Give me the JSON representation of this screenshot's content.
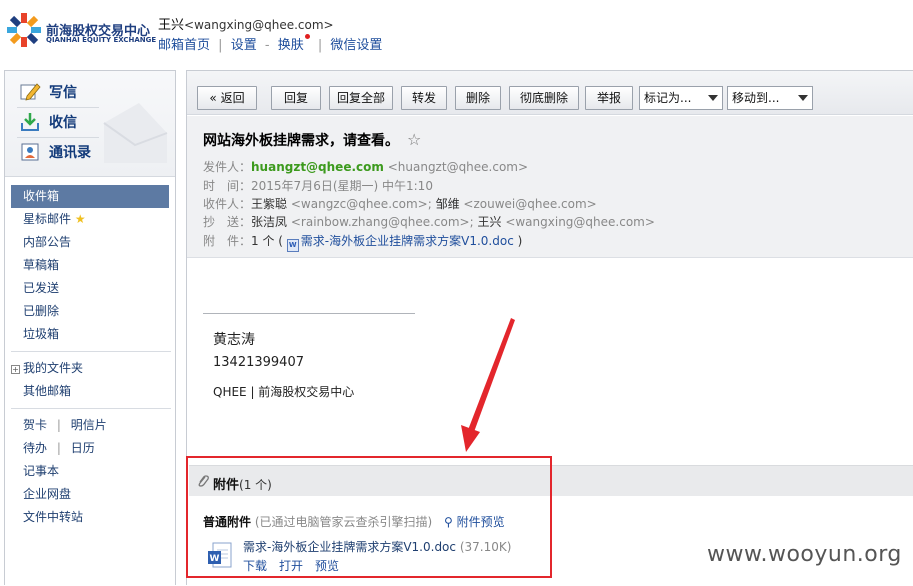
{
  "header": {
    "logo_cn": "前海股权交易中心",
    "logo_en": "QIANHAI EQUITY EXCHANGE",
    "user_name": "王兴",
    "user_email": "<wangxing@qhee.com>",
    "links": [
      "邮箱首页",
      "设置",
      "换肤",
      "微信设置"
    ],
    "separator": "|",
    "dash": "-"
  },
  "sidebar": {
    "compose": "写信",
    "inbox_btn": "收信",
    "contacts": "通讯录",
    "folders": [
      "收件箱",
      "星标邮件",
      "内部公告",
      "草稿箱",
      "已发送",
      "已删除",
      "垃圾箱"
    ],
    "my_folders": "我的文件夹",
    "other_mail": "其他邮箱",
    "tools": {
      "card": "贺卡",
      "postcard": "明信片",
      "todo": "待办",
      "calendar": "日历",
      "notes": "记事本",
      "netdisk": "企业网盘",
      "transfer": "文件中转站",
      "sep": "|"
    },
    "tree_toggle": "+",
    "star_glyph": "★"
  },
  "toolbar": {
    "back": "« 返回",
    "reply": "回复",
    "reply_all": "回复全部",
    "forward": "转发",
    "delete": "删除",
    "delete_perm": "彻底删除",
    "report": "举报",
    "mark_as": "标记为...",
    "move_to": "移动到..."
  },
  "mail": {
    "subject": "网站海外板挂牌需求，请查看。",
    "star": "☆",
    "from_label": "发件人：",
    "from_name": "huangzt@qhee.com",
    "from_email": "<huangzt@qhee.com>",
    "time_label": "时　间：",
    "time_value": "2015年7月6日(星期一) 中午1:10",
    "to_label": "收件人：",
    "to_1_name": "王紫聪",
    "to_1_email": "<wangzc@qhee.com>;",
    "to_2_name": "邹维",
    "to_2_email": "<zouwei@qhee.com>",
    "cc_label": "抄　送：",
    "cc_1_name": "张洁凤",
    "cc_1_email": "<rainbow.zhang@qhee.com>;",
    "cc_2_name": "王兴",
    "cc_2_email": "<wangxing@qhee.com>",
    "att_label": "附　件：",
    "att_count": "1 个 (",
    "att_file": "需求-海外板企业挂牌需求方案V1.0.doc",
    "att_close": ")",
    "doc_glyph": "W"
  },
  "signature": {
    "name": "黄志涛",
    "phone": "13421399407",
    "company": "QHEE | 前海股权交易中心"
  },
  "attachments": {
    "title": "附件",
    "count": "(1 个)",
    "normal_label": "普通附件",
    "scan_note": "(已通过电脑管家云查杀引擎扫描)",
    "preview_all": "附件预览",
    "file_name": "需求-海外板企业挂牌需求方案V1.0.doc",
    "file_size": "(37.10K)",
    "actions": [
      "下载",
      "打开",
      "预览"
    ]
  },
  "watermark": "www.wooyun.org",
  "colors": {
    "active_folder": "#5d7aa3",
    "link": "#1f4e9c",
    "sender_green": "#3c9a1d",
    "highlight_red": "#e3262c"
  }
}
